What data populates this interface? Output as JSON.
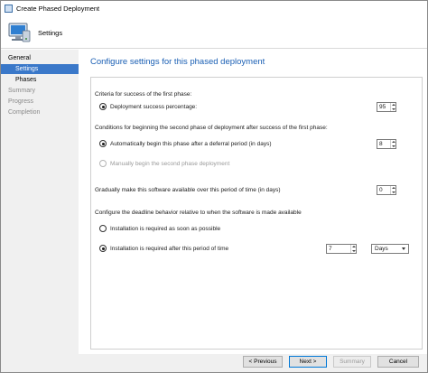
{
  "window": {
    "title": "Create Phased Deployment"
  },
  "header": {
    "label": "Settings",
    "icon": "computer-setup-icon"
  },
  "nav": {
    "items": [
      {
        "label": "General",
        "state": "group"
      },
      {
        "label": "Settings",
        "state": "selected"
      },
      {
        "label": "Phases",
        "state": "sub"
      },
      {
        "label": "Summary",
        "state": "disabled"
      },
      {
        "label": "Progress",
        "state": "disabled"
      },
      {
        "label": "Completion",
        "state": "disabled"
      }
    ]
  },
  "content": {
    "heading": "Configure settings for this phased deployment",
    "criteria_label": "Criteria for success of the first phase:",
    "success_option": "Deployment success percentage:",
    "success_value": "95",
    "conditions_label": "Conditions for beginning the second phase of deployment after success of the first phase:",
    "auto_option": "Automatically begin this phase after a deferral period (in days)",
    "auto_value": "8",
    "manual_option": "Manually begin the second phase deployment",
    "gradual_label": "Gradually make this software available over this period of time (in days)",
    "gradual_value": "0",
    "deadline_label": "Configure the deadline behavior relative to when the software is made available",
    "asap_option": "Installation is required as soon as possible",
    "period_option": "Installation is required after this period of time",
    "period_value": "7",
    "period_unit": "Days"
  },
  "footer": {
    "previous": "< Previous",
    "next": "Next >",
    "summary": "Summary",
    "cancel": "Cancel"
  },
  "colors": {
    "accent": "#1a5fb4",
    "selection": "#3a78c9"
  }
}
